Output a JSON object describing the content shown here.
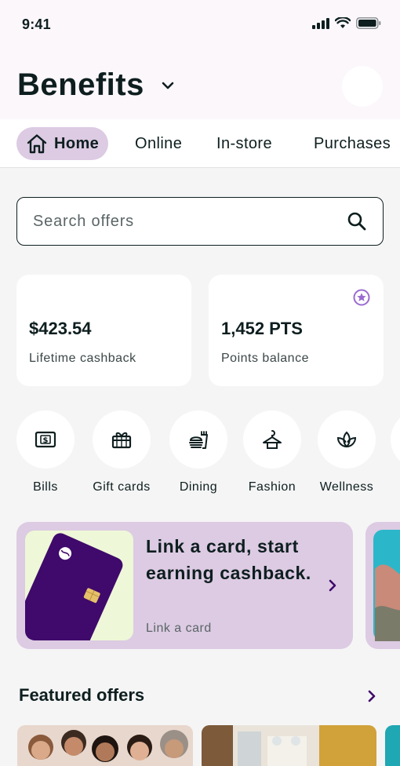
{
  "status_bar": {
    "time": "9:41"
  },
  "header": {
    "title": "Benefits"
  },
  "tabs": [
    {
      "label": "Home"
    },
    {
      "label": "Online"
    },
    {
      "label": "In-store"
    },
    {
      "label": "Purchases"
    }
  ],
  "search": {
    "placeholder": "Search offers"
  },
  "stats": {
    "cashback": {
      "value": "$423.54",
      "label": "Lifetime cashback"
    },
    "points": {
      "value": "1,452 PTS",
      "label": "Points balance"
    }
  },
  "categories": [
    {
      "label": "Bills",
      "icon": "bill-icon"
    },
    {
      "label": "Gift cards",
      "icon": "gift-icon"
    },
    {
      "label": "Dining",
      "icon": "dining-icon"
    },
    {
      "label": "Fashion",
      "icon": "hanger-icon"
    },
    {
      "label": "Wellness",
      "icon": "lotus-icon"
    }
  ],
  "promo": {
    "title": "Link a card, start earning cashback.",
    "link": "Link a card"
  },
  "featured": {
    "title": "Featured offers"
  },
  "colors": {
    "accent": "#dccbe3",
    "card_purple": "#3f0a6b",
    "text": "#0e1e1f",
    "star": "#9b6bd0"
  }
}
